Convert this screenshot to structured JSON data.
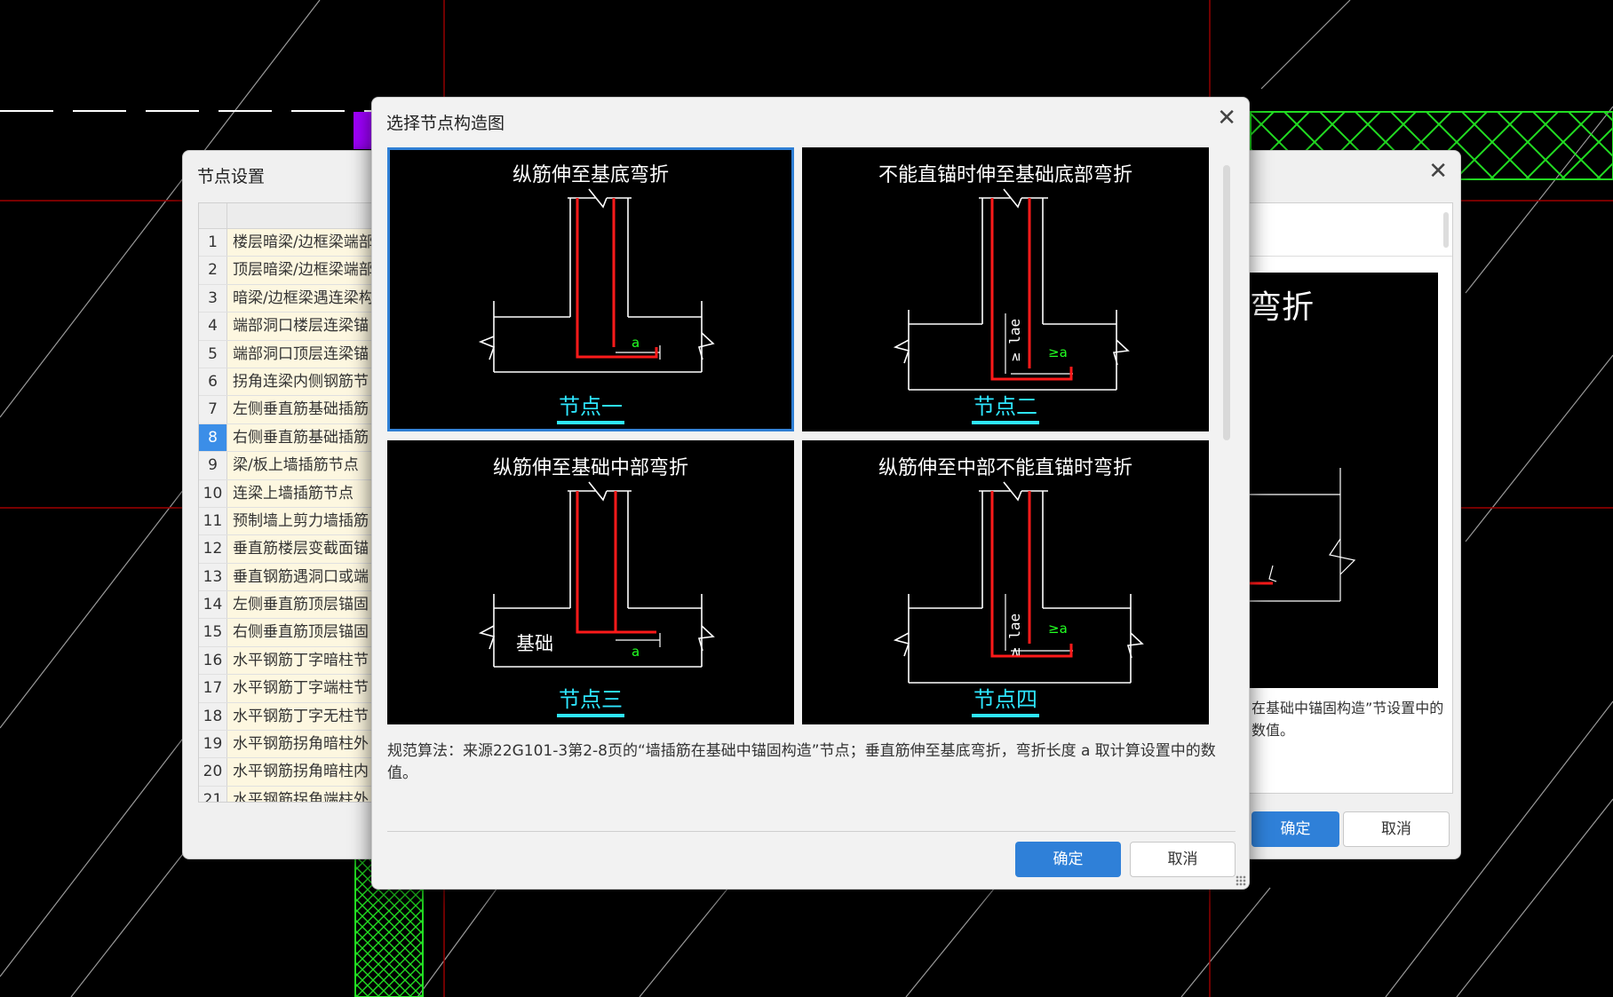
{
  "back_dialog": {
    "title": "节点设置",
    "rows": [
      {
        "num": "1",
        "name": "楼层暗梁/边框梁端部"
      },
      {
        "num": "2",
        "name": "顶层暗梁/边框梁端部"
      },
      {
        "num": "3",
        "name": "暗梁/边框梁遇连梁构"
      },
      {
        "num": "4",
        "name": "端部洞口楼层连梁锚"
      },
      {
        "num": "5",
        "name": "端部洞口顶层连梁锚"
      },
      {
        "num": "6",
        "name": "拐角连梁内侧钢筋节"
      },
      {
        "num": "7",
        "name": "左侧垂直筋基础插筋"
      },
      {
        "num": "8",
        "name": "右侧垂直筋基础插筋"
      },
      {
        "num": "9",
        "name": "梁/板上墙插筋节点"
      },
      {
        "num": "10",
        "name": "连梁上墙插筋节点"
      },
      {
        "num": "11",
        "name": "预制墙上剪力墙插筋"
      },
      {
        "num": "12",
        "name": "垂直筋楼层变截面锚"
      },
      {
        "num": "13",
        "name": "垂直钢筋遇洞口或端"
      },
      {
        "num": "14",
        "name": "左侧垂直筋顶层锚固"
      },
      {
        "num": "15",
        "name": "右侧垂直筋顶层锚固"
      },
      {
        "num": "16",
        "name": "水平钢筋丁字暗柱节"
      },
      {
        "num": "17",
        "name": "水平钢筋丁字端柱节"
      },
      {
        "num": "18",
        "name": "水平钢筋丁字无柱节"
      },
      {
        "num": "19",
        "name": "水平钢筋拐角暗柱外"
      },
      {
        "num": "20",
        "name": "水平钢筋拐角暗柱内"
      },
      {
        "num": "21",
        "name": "水平钢筋拐角端柱外"
      }
    ],
    "selected_row": "8",
    "preview_text": "弯折",
    "desc": "在基础中锚固构造”节设置中的数值。",
    "ok_label": "确定",
    "cancel_label": "取消"
  },
  "select_dialog": {
    "title": "选择节点构造图",
    "nodes": [
      {
        "title": "纵筋伸至基底弯折",
        "label": "节点一",
        "annot": ""
      },
      {
        "title": "不能直锚时伸至基础底部弯折",
        "label": "节点二",
        "annot": ""
      },
      {
        "title": "纵筋伸至基础中部弯折",
        "label": "节点三",
        "annot": "基础"
      },
      {
        "title": "纵筋伸至中部不能直锚时弯折",
        "label": "节点四",
        "annot": ""
      }
    ],
    "selected_node": "节点一",
    "dim_a": "a",
    "dim_ga": "≥a",
    "dim_lae": "≥ lae",
    "description": "规范算法：来源22G101-3第2-8页的“墙插筋在基础中锚固构造”节点；垂直筋伸至基底弯折，弯折长度 a 取计算设置中的数值。",
    "ok_label": "确定",
    "cancel_label": "取消"
  },
  "colors": {
    "accent": "#2f80d8",
    "selected_border": "#2f7fd5",
    "rebar": "#ff1a1a",
    "node_label": "#2ee6ff",
    "dim_text": "#22ff22",
    "hatch": "#22dd22",
    "column_purple": "#a000ff",
    "axis_red": "#b00000"
  }
}
